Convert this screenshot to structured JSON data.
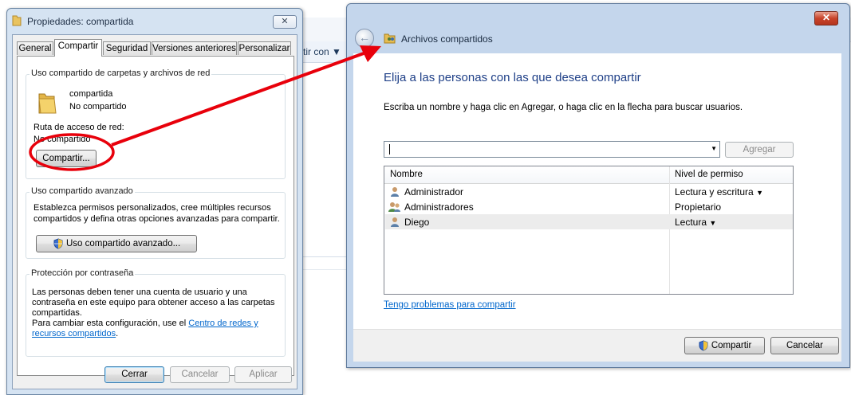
{
  "background_window": {
    "toolbar_fragment": "tir con ▼"
  },
  "properties_dialog": {
    "title": "Propiedades: compartida",
    "close_label": "✕",
    "tabs": [
      "General",
      "Compartir",
      "Seguridad",
      "Versiones anteriores",
      "Personalizar"
    ],
    "active_tab": "Compartir",
    "network_group": {
      "title": "Uso compartido de carpetas y archivos de red",
      "folder_name": "compartida",
      "folder_status": "No compartido",
      "path_label": "Ruta de acceso de red:",
      "path_value": "No compartido",
      "share_button": "Compartir..."
    },
    "advanced_group": {
      "title": "Uso compartido avanzado",
      "description_line1": "Establezca permisos personalizados, cree múltiples recursos",
      "description_line2": "compartidos y defina otras opciones avanzadas para compartir.",
      "button": "Uso compartido avanzado..."
    },
    "password_group": {
      "title": "Protección por contraseña",
      "line1": "Las personas deben tener una cuenta de usuario y una",
      "line2": "contraseña en este equipo para obtener acceso a las carpetas",
      "line3": "compartidas.",
      "line4_prefix": "Para cambiar esta configuración, use el ",
      "link_part1": "Centro de redes y",
      "link_part2": "recursos compartidos",
      "line5_suffix": "."
    },
    "buttons": {
      "ok": "Cerrar",
      "cancel": "Cancelar",
      "apply": "Aplicar"
    }
  },
  "sharing_wizard": {
    "close_label": "✕",
    "back_label": "←",
    "title": "Archivos compartidos",
    "heading": "Elija a las personas con las que desea compartir",
    "instructions": "Escriba un nombre y haga clic en Agregar, o haga clic en la flecha para buscar usuarios.",
    "name_input_value": "",
    "add_button": "Agregar",
    "columns": {
      "name": "Nombre",
      "permission": "Nivel de permiso"
    },
    "rows": [
      {
        "name": "Administrador",
        "permission": "Lectura y escritura",
        "has_dropdown": true,
        "icon": "user-icon"
      },
      {
        "name": "Administradores",
        "permission": "Propietario",
        "has_dropdown": false,
        "icon": "group-icon"
      },
      {
        "name": "Diego",
        "permission": "Lectura",
        "has_dropdown": true,
        "icon": "user-icon",
        "selected": true
      }
    ],
    "help_link": "Tengo problemas para compartir",
    "share_button": "Compartir",
    "cancel_button": "Cancelar"
  },
  "annotation": {
    "color": "#e8000b"
  }
}
